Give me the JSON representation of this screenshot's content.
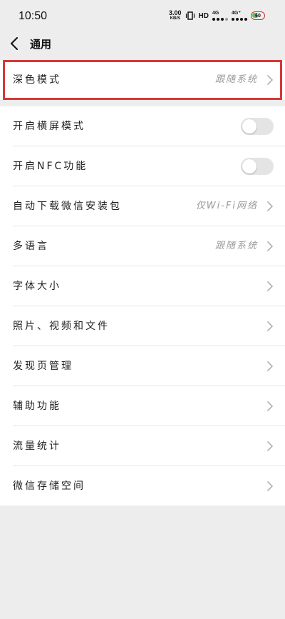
{
  "status_bar": {
    "time": "10:50",
    "net_speed_value": "3.00",
    "net_speed_unit": "KB/S",
    "hd_label": "HD",
    "sim1_label": "4G",
    "sim2_label": "4G⁺",
    "battery_level": "60"
  },
  "nav": {
    "title": "通用"
  },
  "dark_mode": {
    "label": "深色模式",
    "value": "跟随系统"
  },
  "settings": {
    "landscape": {
      "label": "开启横屏模式",
      "toggle_on": false
    },
    "nfc": {
      "label": "开启NFC功能",
      "toggle_on": false
    },
    "auto_download": {
      "label": "自动下载微信安装包",
      "value": "仅Wi-Fi网络"
    },
    "language": {
      "label": "多语言",
      "value": "跟随系统"
    },
    "font_size": {
      "label": "字体大小"
    },
    "media": {
      "label": "照片、视频和文件"
    },
    "discover": {
      "label": "发现页管理"
    },
    "accessibility": {
      "label": "辅助功能"
    },
    "data_usage": {
      "label": "流量统计"
    },
    "storage": {
      "label": "微信存储空间"
    }
  },
  "colors": {
    "background": "#ededed",
    "highlight_border": "#d93636",
    "toggle_off": "#e4e4e4"
  }
}
